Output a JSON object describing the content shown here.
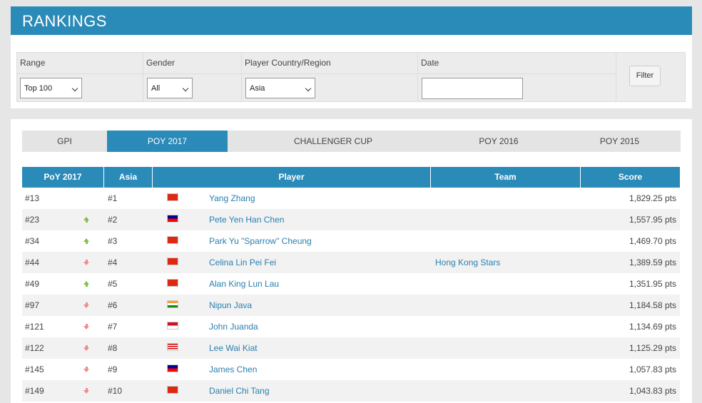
{
  "page": {
    "title": "RANKINGS"
  },
  "filters": {
    "range": {
      "label": "Range",
      "value": "Top 100"
    },
    "gender": {
      "label": "Gender",
      "value": "All"
    },
    "country": {
      "label": "Player Country/Region",
      "value": "Asia"
    },
    "date": {
      "label": "Date",
      "value": ""
    },
    "filter_button": "Filter"
  },
  "tabs": [
    {
      "label": "GPI",
      "active": false
    },
    {
      "label": "POY 2017",
      "active": true
    },
    {
      "label": "CHALLENGER CUP",
      "active": false
    },
    {
      "label": "POY 2016",
      "active": false
    },
    {
      "label": "POY 2015",
      "active": false
    }
  ],
  "table": {
    "columns": [
      "PoY 2017",
      "Asia",
      "Player",
      "Team",
      "Score"
    ],
    "rows": [
      {
        "poy": "#13",
        "trend": "none",
        "asia": "#1",
        "flag": "china-flag",
        "player": "Yang Zhang",
        "team": "",
        "score": "1,829.25 pts"
      },
      {
        "poy": "#23",
        "trend": "up",
        "asia": "#2",
        "flag": "taiwan-flag",
        "player": "Pete Yen Han Chen",
        "team": "",
        "score": "1,557.95 pts"
      },
      {
        "poy": "#34",
        "trend": "up",
        "asia": "#3",
        "flag": "hong-kong-flag",
        "player": "Park Yu \"Sparrow\" Cheung",
        "team": "",
        "score": "1,469.70 pts"
      },
      {
        "poy": "#44",
        "trend": "down",
        "asia": "#4",
        "flag": "china-flag",
        "player": "Celina Lin Pei Fei",
        "team": "Hong Kong Stars",
        "score": "1,389.59 pts"
      },
      {
        "poy": "#49",
        "trend": "up",
        "asia": "#5",
        "flag": "hong-kong-flag",
        "player": "Alan King Lun Lau",
        "team": "",
        "score": "1,351.95 pts"
      },
      {
        "poy": "#97",
        "trend": "down",
        "asia": "#6",
        "flag": "india-flag",
        "player": "Nipun Java",
        "team": "",
        "score": "1,184.58 pts"
      },
      {
        "poy": "#121",
        "trend": "down",
        "asia": "#7",
        "flag": "indonesia-flag",
        "player": "John Juanda",
        "team": "",
        "score": "1,134.69 pts"
      },
      {
        "poy": "#122",
        "trend": "down",
        "asia": "#8",
        "flag": "malaysia-flag",
        "player": "Lee Wai Kiat",
        "team": "",
        "score": "1,125.29 pts"
      },
      {
        "poy": "#145",
        "trend": "down",
        "asia": "#9",
        "flag": "taiwan-flag",
        "player": "James Chen",
        "team": "",
        "score": "1,057.83 pts"
      },
      {
        "poy": "#149",
        "trend": "down",
        "asia": "#10",
        "flag": "hong-kong-flag",
        "player": "Daniel Chi Tang",
        "team": "",
        "score": "1,043.83 pts"
      }
    ]
  },
  "colors": {
    "accent": "#2a8ab8",
    "link": "#2a7fb0",
    "up": "#7cc243",
    "down": "#f08a8a"
  }
}
